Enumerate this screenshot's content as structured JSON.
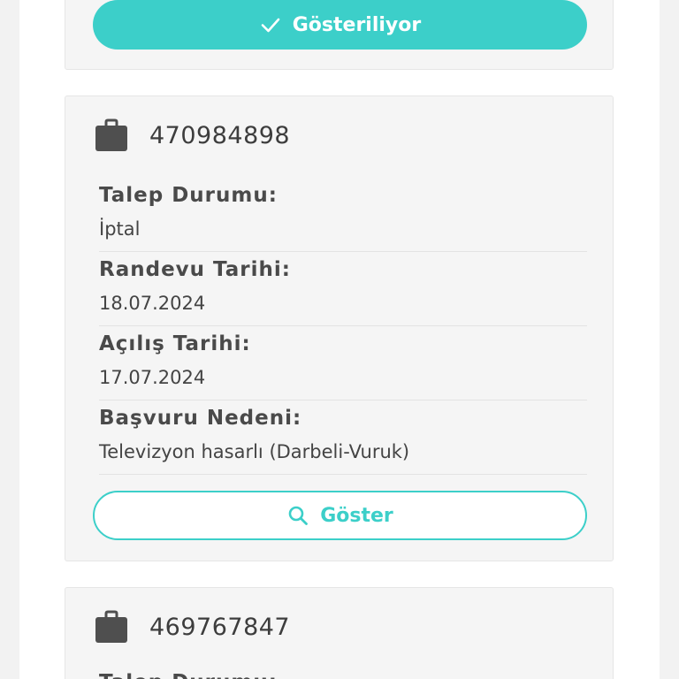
{
  "top_card": {
    "button_label": "Gösteriliyor",
    "button_icon": "check-icon"
  },
  "cards": [
    {
      "ticket_no": "470984898",
      "icon": "briefcase-icon",
      "fields": [
        {
          "label": "Talep Durumu:",
          "value": "İptal"
        },
        {
          "label": "Randevu Tarihi:",
          "value": "18.07.2024"
        },
        {
          "label": "Açılış Tarihi:",
          "value": "17.07.2024"
        },
        {
          "label": "Başvuru Nedeni:",
          "value": "Televizyon hasarlı (Darbeli-Vuruk)"
        }
      ],
      "button_label": "Göster",
      "button_icon": "search-icon"
    },
    {
      "ticket_no": "469767847",
      "icon": "briefcase-icon",
      "partial_label": "Talep Durumu:"
    }
  ],
  "colors": {
    "accent": "#3ccfc9",
    "text": "#3d3d3d",
    "card_bg": "#f5f5f5",
    "page_bg": "#f2f2f2"
  }
}
